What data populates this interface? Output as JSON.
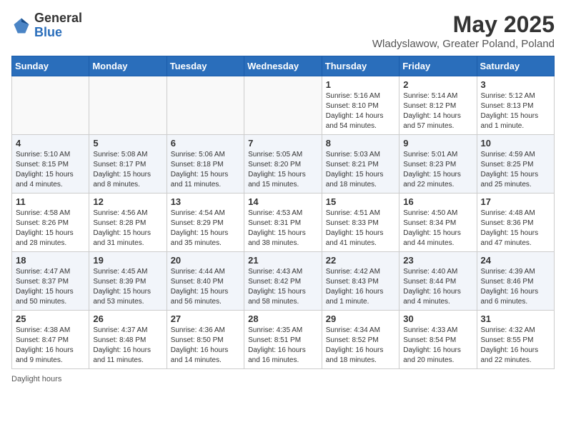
{
  "header": {
    "logo_general": "General",
    "logo_blue": "Blue",
    "month_title": "May 2025",
    "location": "Wladyslawow, Greater Poland, Poland"
  },
  "days_of_week": [
    "Sunday",
    "Monday",
    "Tuesday",
    "Wednesday",
    "Thursday",
    "Friday",
    "Saturday"
  ],
  "weeks": [
    [
      {
        "day": "",
        "info": ""
      },
      {
        "day": "",
        "info": ""
      },
      {
        "day": "",
        "info": ""
      },
      {
        "day": "",
        "info": ""
      },
      {
        "day": "1",
        "info": "Sunrise: 5:16 AM\nSunset: 8:10 PM\nDaylight: 14 hours and 54 minutes."
      },
      {
        "day": "2",
        "info": "Sunrise: 5:14 AM\nSunset: 8:12 PM\nDaylight: 14 hours and 57 minutes."
      },
      {
        "day": "3",
        "info": "Sunrise: 5:12 AM\nSunset: 8:13 PM\nDaylight: 15 hours and 1 minute."
      }
    ],
    [
      {
        "day": "4",
        "info": "Sunrise: 5:10 AM\nSunset: 8:15 PM\nDaylight: 15 hours and 4 minutes."
      },
      {
        "day": "5",
        "info": "Sunrise: 5:08 AM\nSunset: 8:17 PM\nDaylight: 15 hours and 8 minutes."
      },
      {
        "day": "6",
        "info": "Sunrise: 5:06 AM\nSunset: 8:18 PM\nDaylight: 15 hours and 11 minutes."
      },
      {
        "day": "7",
        "info": "Sunrise: 5:05 AM\nSunset: 8:20 PM\nDaylight: 15 hours and 15 minutes."
      },
      {
        "day": "8",
        "info": "Sunrise: 5:03 AM\nSunset: 8:21 PM\nDaylight: 15 hours and 18 minutes."
      },
      {
        "day": "9",
        "info": "Sunrise: 5:01 AM\nSunset: 8:23 PM\nDaylight: 15 hours and 22 minutes."
      },
      {
        "day": "10",
        "info": "Sunrise: 4:59 AM\nSunset: 8:25 PM\nDaylight: 15 hours and 25 minutes."
      }
    ],
    [
      {
        "day": "11",
        "info": "Sunrise: 4:58 AM\nSunset: 8:26 PM\nDaylight: 15 hours and 28 minutes."
      },
      {
        "day": "12",
        "info": "Sunrise: 4:56 AM\nSunset: 8:28 PM\nDaylight: 15 hours and 31 minutes."
      },
      {
        "day": "13",
        "info": "Sunrise: 4:54 AM\nSunset: 8:29 PM\nDaylight: 15 hours and 35 minutes."
      },
      {
        "day": "14",
        "info": "Sunrise: 4:53 AM\nSunset: 8:31 PM\nDaylight: 15 hours and 38 minutes."
      },
      {
        "day": "15",
        "info": "Sunrise: 4:51 AM\nSunset: 8:33 PM\nDaylight: 15 hours and 41 minutes."
      },
      {
        "day": "16",
        "info": "Sunrise: 4:50 AM\nSunset: 8:34 PM\nDaylight: 15 hours and 44 minutes."
      },
      {
        "day": "17",
        "info": "Sunrise: 4:48 AM\nSunset: 8:36 PM\nDaylight: 15 hours and 47 minutes."
      }
    ],
    [
      {
        "day": "18",
        "info": "Sunrise: 4:47 AM\nSunset: 8:37 PM\nDaylight: 15 hours and 50 minutes."
      },
      {
        "day": "19",
        "info": "Sunrise: 4:45 AM\nSunset: 8:39 PM\nDaylight: 15 hours and 53 minutes."
      },
      {
        "day": "20",
        "info": "Sunrise: 4:44 AM\nSunset: 8:40 PM\nDaylight: 15 hours and 56 minutes."
      },
      {
        "day": "21",
        "info": "Sunrise: 4:43 AM\nSunset: 8:42 PM\nDaylight: 15 hours and 58 minutes."
      },
      {
        "day": "22",
        "info": "Sunrise: 4:42 AM\nSunset: 8:43 PM\nDaylight: 16 hours and 1 minute."
      },
      {
        "day": "23",
        "info": "Sunrise: 4:40 AM\nSunset: 8:44 PM\nDaylight: 16 hours and 4 minutes."
      },
      {
        "day": "24",
        "info": "Sunrise: 4:39 AM\nSunset: 8:46 PM\nDaylight: 16 hours and 6 minutes."
      }
    ],
    [
      {
        "day": "25",
        "info": "Sunrise: 4:38 AM\nSunset: 8:47 PM\nDaylight: 16 hours and 9 minutes."
      },
      {
        "day": "26",
        "info": "Sunrise: 4:37 AM\nSunset: 8:48 PM\nDaylight: 16 hours and 11 minutes."
      },
      {
        "day": "27",
        "info": "Sunrise: 4:36 AM\nSunset: 8:50 PM\nDaylight: 16 hours and 14 minutes."
      },
      {
        "day": "28",
        "info": "Sunrise: 4:35 AM\nSunset: 8:51 PM\nDaylight: 16 hours and 16 minutes."
      },
      {
        "day": "29",
        "info": "Sunrise: 4:34 AM\nSunset: 8:52 PM\nDaylight: 16 hours and 18 minutes."
      },
      {
        "day": "30",
        "info": "Sunrise: 4:33 AM\nSunset: 8:54 PM\nDaylight: 16 hours and 20 minutes."
      },
      {
        "day": "31",
        "info": "Sunrise: 4:32 AM\nSunset: 8:55 PM\nDaylight: 16 hours and 22 minutes."
      }
    ]
  ],
  "footer": {
    "daylight_hours": "Daylight hours"
  }
}
